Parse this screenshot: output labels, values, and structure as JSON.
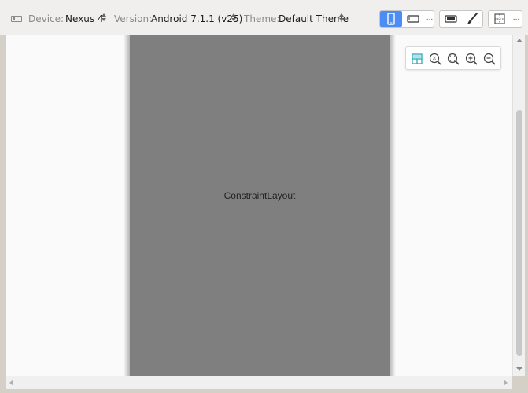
{
  "toolbar": {
    "device": {
      "label": "Device:",
      "value": "Nexus 4"
    },
    "version": {
      "label": "Version:",
      "value": "Android 7.1.1 (v25)"
    },
    "theme": {
      "label": "Theme:",
      "value": "Default Theme"
    },
    "orientation_more": "...",
    "mode_more": "..."
  },
  "canvas": {
    "root_layout_label": "ConstraintLayout"
  },
  "colors": {
    "accent": "#4c8cf5",
    "phone_background": "#7f7f7f",
    "canvas_background": "#fafafa",
    "teal_icon": "#2aa8b6"
  },
  "icons": {
    "device": "device-frame-icon",
    "portrait": "portrait-phone-icon",
    "landscape": "landscape-phone-icon",
    "design_surface": "design-surface-icon",
    "paint": "paintbrush-icon",
    "blueprint": "blueprint-layout-icon",
    "pan": "pan-layout-icon",
    "zoom_actual": "zoom-actual-icon",
    "zoom_fit": "zoom-fit-icon",
    "zoom_in": "zoom-in-icon",
    "zoom_out": "zoom-out-icon"
  }
}
